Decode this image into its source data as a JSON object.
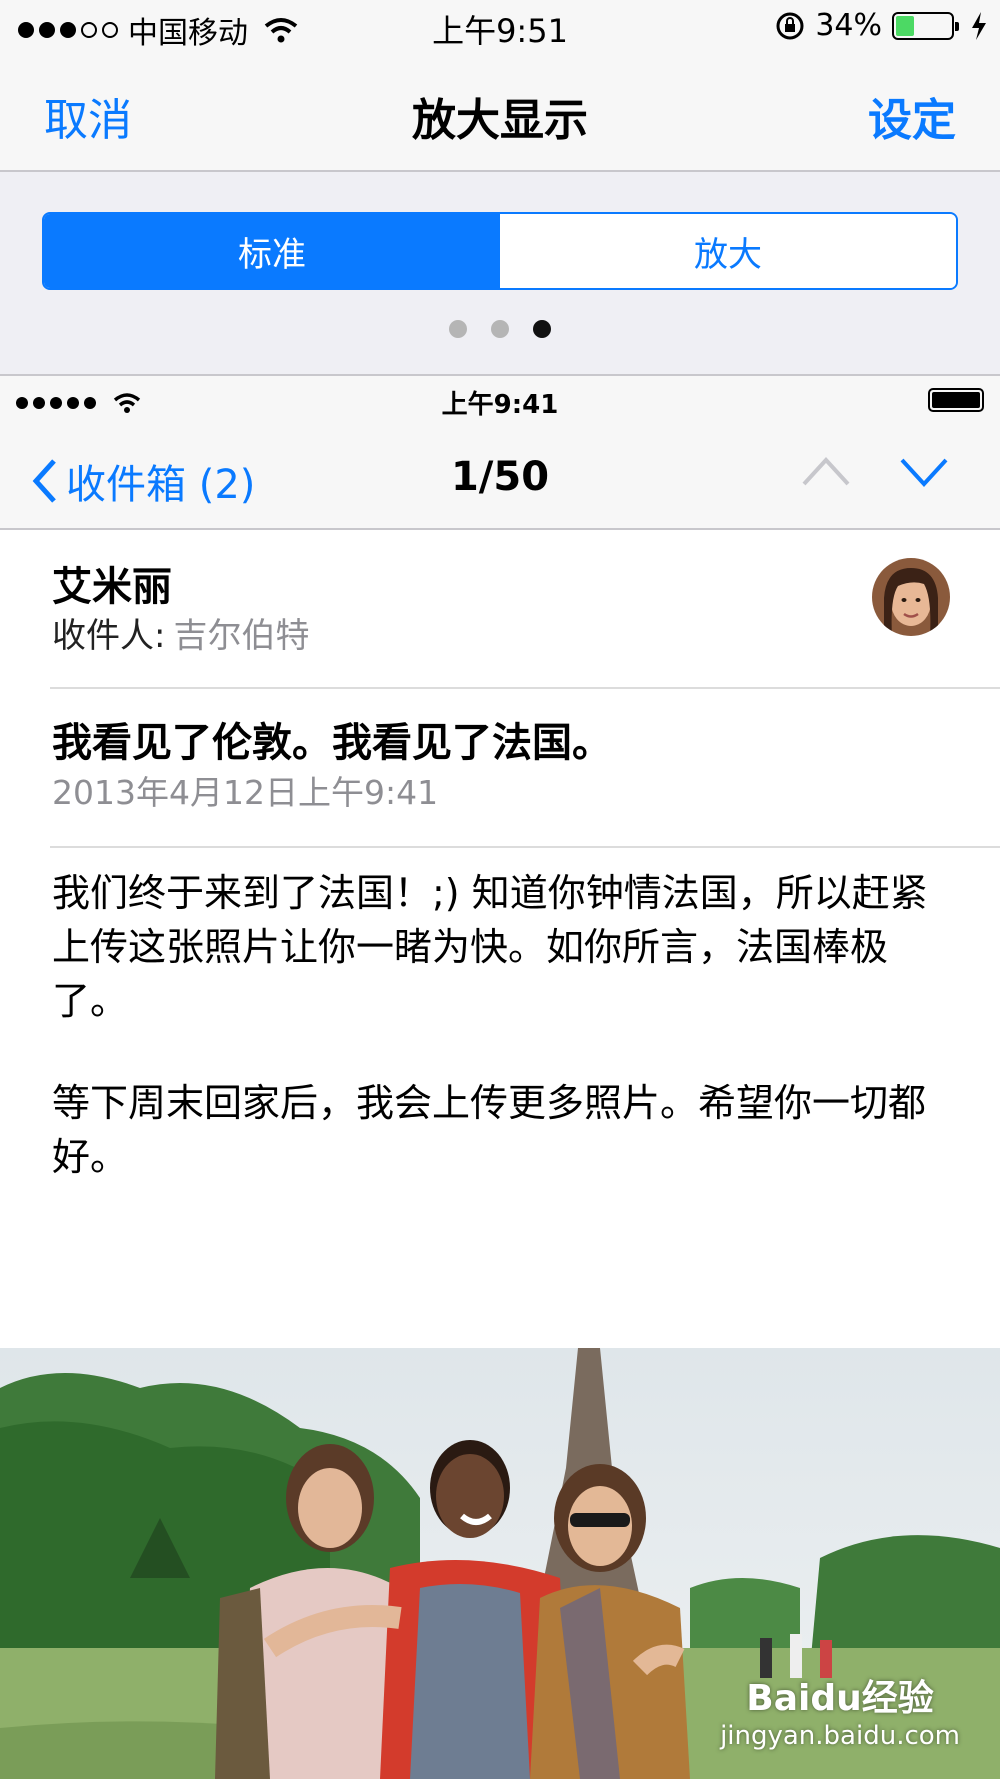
{
  "status_outer": {
    "carrier": "中国移动",
    "time": "上午9:51",
    "battery_percent": "34%"
  },
  "nav_outer": {
    "cancel": "取消",
    "title": "放大显示",
    "set": "设定"
  },
  "segment": {
    "standard": "标准",
    "zoomed": "放大",
    "selected": "标准"
  },
  "pager": {
    "total": 3,
    "current": 3
  },
  "status_inner": {
    "time": "上午9:41"
  },
  "nav_inner": {
    "back_label": "收件箱 (2)",
    "counter": "1/50"
  },
  "mail": {
    "sender": "艾米丽",
    "to_label": "收件人:",
    "to_value": "吉尔伯特",
    "subject": "我看见了伦敦。我看见了法国。",
    "date": "2013年4月12日上午9:41",
    "body_paragraph_1": "我们终于来到了法国！;) 知道你钟情法国，所以赶紧上传这张照片让你一睹为快。如你所言，法国棒极了。",
    "body_paragraph_2": "等下周末回家后，我会上传更多照片。希望你一切都好。"
  },
  "watermark": {
    "line1": "Baidu经验",
    "line2": "jingyan.baidu.com"
  },
  "colors": {
    "accent": "#0a7aff",
    "battery_green": "#4cd964",
    "secondary_text": "#8e8e93"
  }
}
